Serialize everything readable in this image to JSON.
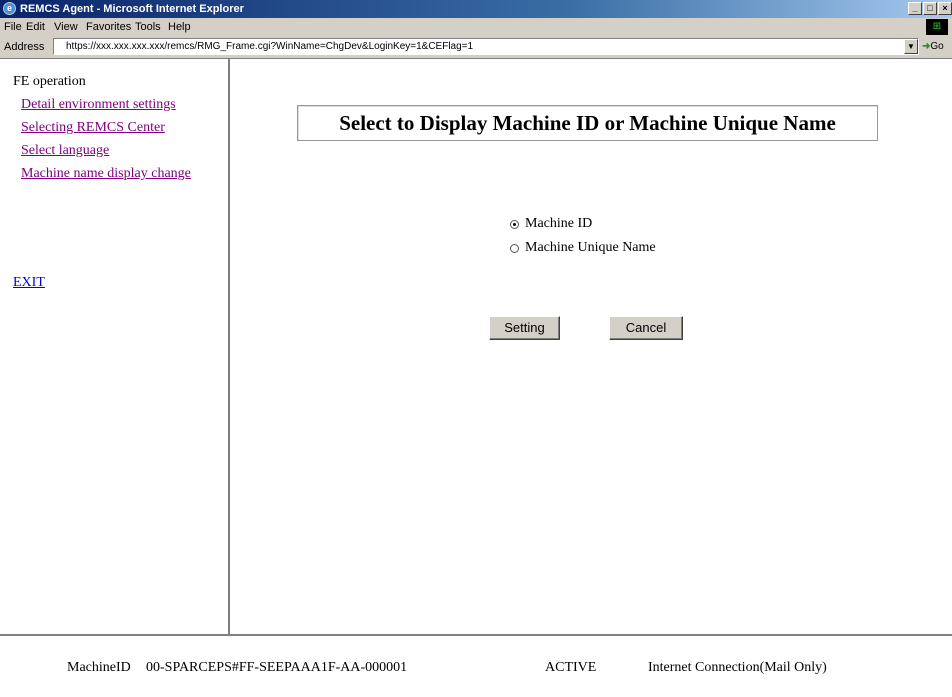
{
  "window": {
    "title": "REMCS Agent - Microsoft Internet Explorer",
    "icon": "ie-icon",
    "buttons": [
      "_",
      "□",
      "×"
    ]
  },
  "menubar": {
    "items": [
      "File",
      "Edit",
      "View",
      "Favorites",
      "Tools",
      "Help"
    ]
  },
  "addressbar": {
    "label": "Address",
    "url": "https://xxx.xxx.xxx.xxx/remcs/RMG_Frame.cgi?WinName=ChgDev&LoginKey=1&CEFlag=1",
    "go_label": "Go"
  },
  "sidebar": {
    "header": "FE operation",
    "links": [
      "Detail environment settings",
      "Selecting REMCS Center",
      "Select language",
      "Machine name display change"
    ],
    "exit": "EXIT"
  },
  "main": {
    "heading": "Select to Display Machine ID or Machine Unique Name",
    "options": [
      {
        "label": "Machine ID",
        "selected": true
      },
      {
        "label": "Machine Unique Name",
        "selected": false
      }
    ],
    "setting_button": "Setting",
    "cancel_button": "Cancel"
  },
  "status": {
    "machine_label": "MachineID",
    "machine_id": "00-SPARCEPS#FF-SEEPAAA1F-AA-000001",
    "state": "ACTIVE",
    "connection": "Internet Connection(Mail Only)"
  }
}
